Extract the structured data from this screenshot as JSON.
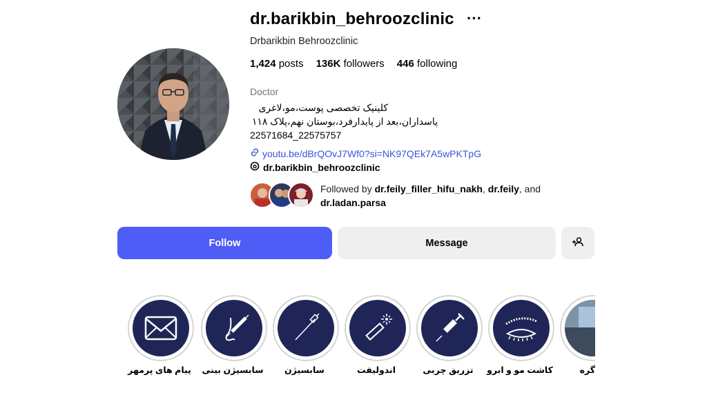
{
  "profile": {
    "username": "dr.barikbin_behroozclinic",
    "more_label": "···",
    "full_name": "Drbarikbin Behroozclinic",
    "stats": {
      "posts_count": "1,424",
      "posts_label": "posts",
      "followers_count": "136K",
      "followers_label": "followers",
      "following_count": "446",
      "following_label": "following"
    },
    "category": "Doctor",
    "bio": [
      "کلینیک تخصصی پوست،مو،لاغری",
      "پاسداران،بعد از پایدارفرد،بوستان نهم،پلاک ۱۱۸",
      "22571684_22575757"
    ],
    "link": "youtu.be/dBrQOvJ7Wf0?si=NK97QEk7A5wPKTpG",
    "threads_handle": "dr.barikbin_behroozclinic",
    "followed_by": {
      "prefix": "Followed by",
      "user1": "dr.feily_filler_hifu_nakh",
      "sep1": ",",
      "user2": "dr.feily",
      "sep2": ", and",
      "user3": "dr.ladan.parsa"
    }
  },
  "actions": {
    "follow_label": "Follow",
    "message_label": "Message",
    "add_user_icon": "person-add-icon"
  },
  "highlights": [
    {
      "label": "پیام های پرمهر",
      "icon": "envelope-icon"
    },
    {
      "label": "سابسیژن بینی",
      "icon": "nose-syringe-icon"
    },
    {
      "label": "سابسیژن",
      "icon": "needle-icon"
    },
    {
      "label": "اندولیفت",
      "icon": "laser-icon"
    },
    {
      "label": "تزریق چربی",
      "icon": "syringe-icon"
    },
    {
      "label": "کاشت مو و ابرو",
      "icon": "eyebrow-icon"
    },
    {
      "label": "گره",
      "icon": "photo-thumbnail"
    }
  ],
  "colors": {
    "accent": "#4e5df6",
    "link": "#3b54d6",
    "highlight_bg": "#1f2657",
    "secondary_button": "#efefef"
  }
}
